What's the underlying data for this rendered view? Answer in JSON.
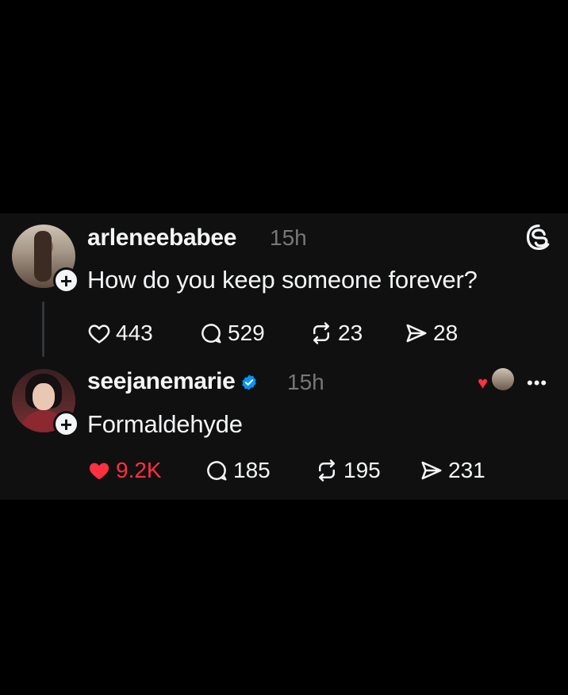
{
  "posts": [
    {
      "username": "arleneebabee",
      "time": "15h",
      "text": "How do you keep someone forever?",
      "likes": "443",
      "replies": "529",
      "reposts": "23",
      "shares": "28",
      "liked": false
    },
    {
      "username": "seejanemarie",
      "verified": true,
      "time": "15h",
      "text": "Formaldehyde",
      "likes": "9.2K",
      "replies": "185",
      "reposts": "195",
      "shares": "231",
      "liked": true
    }
  ],
  "icons": {
    "like": "heart-icon",
    "reply": "comment-icon",
    "repost": "repost-icon",
    "share": "send-icon",
    "brand": "threads-logo-icon",
    "more": "more-icon",
    "follow": "plus-icon"
  },
  "colors": {
    "background": "#000000",
    "card": "#101010",
    "text": "#f3f5f7",
    "muted": "#777777",
    "like_red": "#ff3040",
    "verified_blue": "#0095f6"
  },
  "more_label": "•••"
}
